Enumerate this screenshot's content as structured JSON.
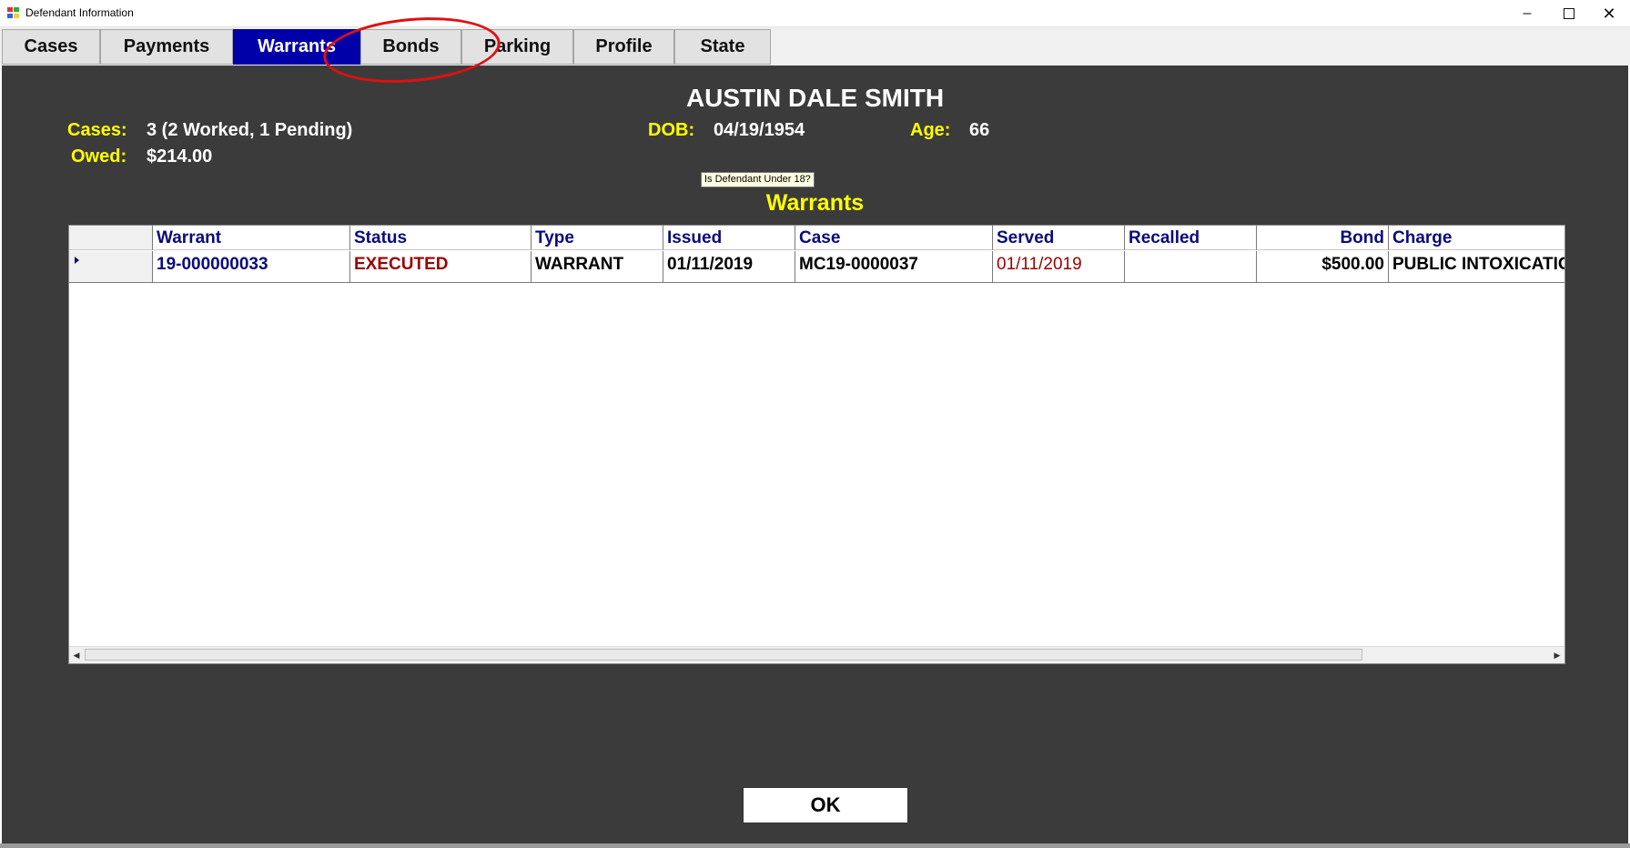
{
  "window": {
    "title": "Defendant Information"
  },
  "tabs": [
    {
      "label": "Cases"
    },
    {
      "label": "Payments"
    },
    {
      "label": "Warrants"
    },
    {
      "label": "Bonds"
    },
    {
      "label": "Parking"
    },
    {
      "label": "Profile"
    },
    {
      "label": "State"
    }
  ],
  "active_tab": "Warrants",
  "defendant": {
    "name": "AUSTIN DALE SMITH",
    "cases_label": "Cases:",
    "cases_value": "3 (2 Worked, 1 Pending)",
    "owed_label": "Owed:",
    "owed_value": "$214.00",
    "dob_label": "DOB:",
    "dob_value": "04/19/1954",
    "age_label": "Age:",
    "age_value": "66"
  },
  "tooltip": "Is Defendant Under 18?",
  "section_title": "Warrants",
  "grid": {
    "columns": [
      "Warrant",
      "Status",
      "Type",
      "Issued",
      "Case",
      "Served",
      "Recalled",
      "Bond",
      "Charge"
    ],
    "rows": [
      {
        "warrant": "19-000000033",
        "status": "EXECUTED",
        "type": "WARRANT",
        "issued": "01/11/2019",
        "case": "MC19-0000037",
        "served": "01/11/2019",
        "recalled": "",
        "bond": "$500.00",
        "charge": "PUBLIC INTOXICATION"
      }
    ]
  },
  "ok_label": "OK",
  "colors": {
    "panel_bg": "#3b3b3b",
    "accent_label": "#ffff00",
    "active_tab": "#0000a8",
    "header_text": "#0a0a7a",
    "status_red": "#9b0000",
    "annotation": "#e01010"
  }
}
